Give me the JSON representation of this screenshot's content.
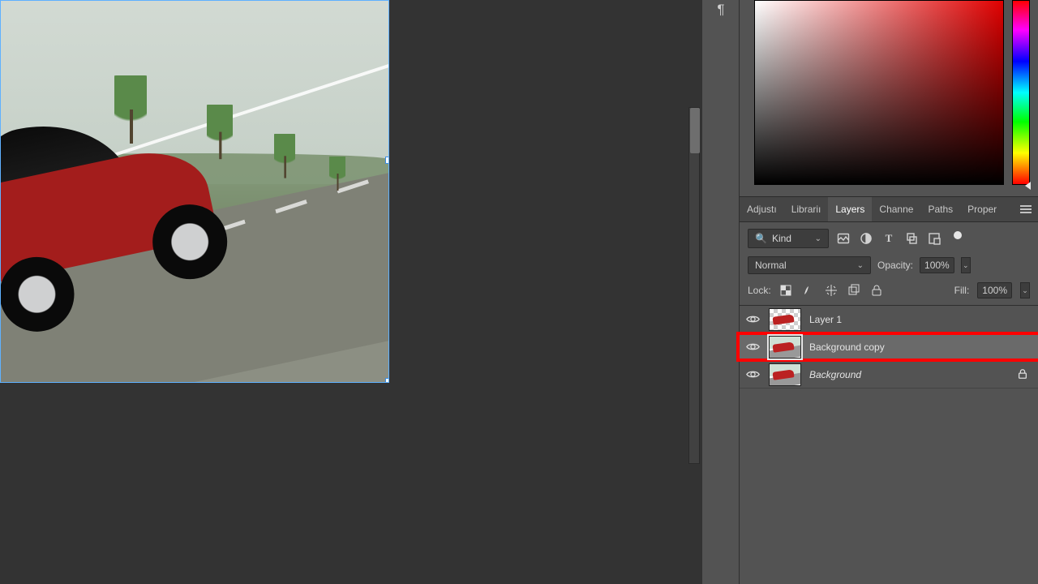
{
  "panel_tabs": {
    "adjustments": "Adjustı",
    "libraries": "Librariı",
    "layers": "Layers",
    "channels": "Channe",
    "paths": "Paths",
    "properties": "Proper"
  },
  "layers_panel": {
    "kind_filter_label": "Kind",
    "blend_mode": "Normal",
    "opacity_label": "Opacity:",
    "opacity_value": "100%",
    "lock_label": "Lock:",
    "fill_label": "Fill:",
    "fill_value": "100%",
    "layers": [
      {
        "name": "Layer 1",
        "visible": true,
        "selected": false,
        "locked": false,
        "italic": false,
        "thumb": "checker-car"
      },
      {
        "name": "Background copy",
        "visible": true,
        "selected": true,
        "locked": false,
        "italic": false,
        "thumb": "photo",
        "highlighted": true
      },
      {
        "name": "Background",
        "visible": true,
        "selected": false,
        "locked": true,
        "italic": true,
        "thumb": "photo"
      }
    ]
  },
  "icon_labels": {
    "paragraph_panel": "paragraph",
    "filter_image": "image-layers",
    "filter_adjust": "adjustment-layers",
    "filter_type": "type-layers",
    "filter_shape": "shape-layers",
    "filter_smart": "smart-objects"
  }
}
